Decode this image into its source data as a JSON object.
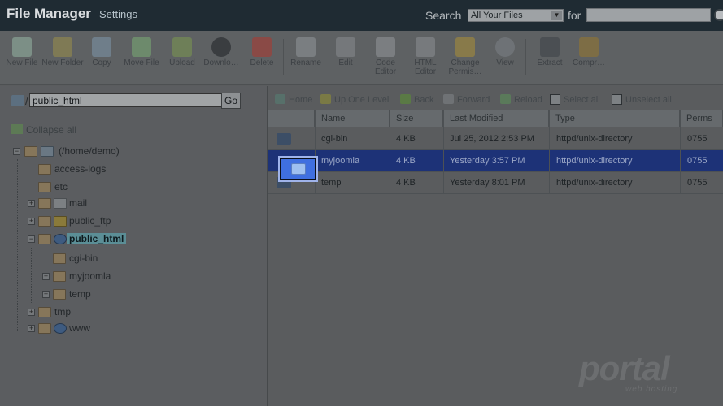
{
  "header": {
    "title": "File Manager",
    "settings_label": "Settings",
    "search_label": "Search",
    "search_scope": "All Your Files",
    "for_label": "for",
    "search_value": ""
  },
  "toolbar": {
    "items": [
      {
        "label": "New File",
        "icon": "new-file-icon"
      },
      {
        "label": "New Folder",
        "icon": "new-folder-icon"
      },
      {
        "label": "Copy",
        "icon": "copy-icon"
      },
      {
        "label": "Move File",
        "icon": "move-file-icon"
      },
      {
        "label": "Upload",
        "icon": "upload-icon"
      },
      {
        "label": "Downlo…",
        "icon": "download-icon"
      },
      {
        "label": "Delete",
        "icon": "delete-icon"
      },
      {
        "label": "Rename",
        "icon": "rename-icon"
      },
      {
        "label": "Edit",
        "icon": "edit-icon"
      },
      {
        "label": "Code Editor",
        "icon": "code-editor-icon"
      },
      {
        "label": "HTML Editor",
        "icon": "html-editor-icon"
      },
      {
        "label": "Change Permis…",
        "icon": "permissions-icon"
      },
      {
        "label": "View",
        "icon": "view-icon"
      },
      {
        "label": "Extract",
        "icon": "extract-icon"
      },
      {
        "label": "Compr…",
        "icon": "compress-icon"
      }
    ]
  },
  "left": {
    "path_value": "public_html",
    "go_label": "Go",
    "collapse_all": "Collapse all",
    "tree": [
      {
        "label": "(/home/demo)"
      },
      {
        "label": "access-logs"
      },
      {
        "label": "etc"
      },
      {
        "label": "mail"
      },
      {
        "label": "public_ftp"
      },
      {
        "label": "public_html"
      },
      {
        "label": "cgi-bin"
      },
      {
        "label": "myjoomla"
      },
      {
        "label": "temp"
      },
      {
        "label": "tmp"
      },
      {
        "label": "www"
      }
    ]
  },
  "nav": {
    "home": "Home",
    "up": "Up One Level",
    "back": "Back",
    "forward": "Forward",
    "reload": "Reload",
    "select_all": "Select all",
    "unselect_all": "Unselect all"
  },
  "table": {
    "headers": [
      "Name",
      "Size",
      "Last Modified",
      "Type",
      "Perms"
    ],
    "rows": [
      {
        "name": "cgi-bin",
        "size": "4 KB",
        "modified": "Jul 25, 2012 2:53 PM",
        "type": "httpd/unix-directory",
        "perms": "0755"
      },
      {
        "name": "myjoomla",
        "size": "4 KB",
        "modified": "Yesterday 3:57 PM",
        "type": "httpd/unix-directory",
        "perms": "0755"
      },
      {
        "name": "temp",
        "size": "4 KB",
        "modified": "Yesterday 8:01 PM",
        "type": "httpd/unix-directory",
        "perms": "0755"
      }
    ]
  },
  "watermark": {
    "brand": "portal",
    "sub": "web hosting"
  },
  "colors": {
    "selected_row": "#1d3277",
    "highlight": "#3f6fe0",
    "tree_selected": "#5b8e96"
  }
}
